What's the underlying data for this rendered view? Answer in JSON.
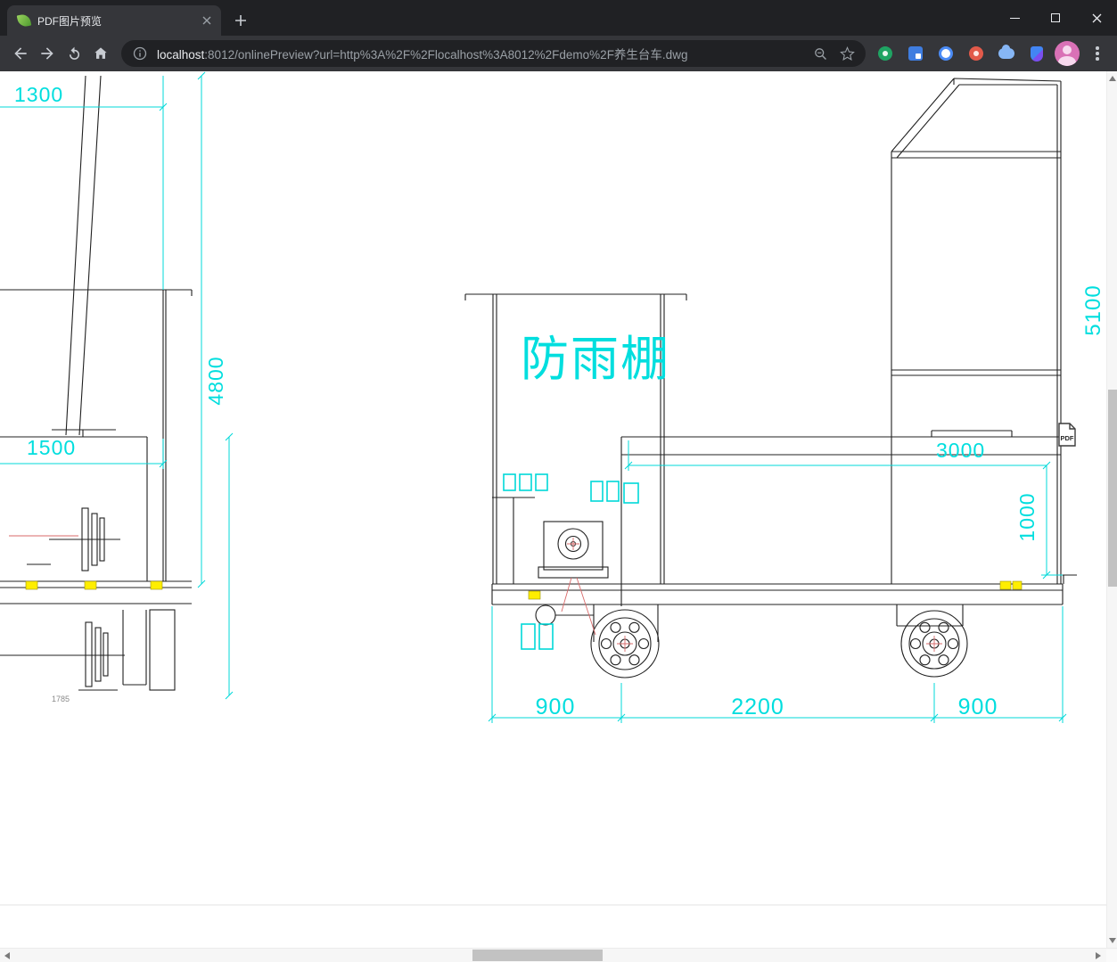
{
  "window": {
    "tab": {
      "title": "PDF图片预览"
    }
  },
  "toolbar": {
    "address": {
      "host": "localhost",
      "rest": ":8012/onlinePreview?url=http%3A%2F%2Flocalhost%3A8012%2Fdemo%2F养生台车.dwg"
    },
    "icons": [
      "back-icon",
      "forward-icon",
      "reload-icon",
      "home-icon",
      "info-icon",
      "zoom-icon",
      "star-icon",
      "extension-green",
      "extension-translate",
      "extension-ring",
      "extension-red",
      "extension-cloud",
      "extension-shield",
      "profile-avatar",
      "menu-icon"
    ]
  },
  "overlay": {
    "pdf_icon_label": "PDF"
  },
  "cad": {
    "shelter_label": "防雨棚",
    "dims": {
      "top_left_width": "1300",
      "left_height": "4800",
      "left_width": "1500",
      "right_height": "5100",
      "platform_width": "3000",
      "platform_height": "1000",
      "axle_left": "900",
      "axle_span": "2200",
      "axle_right": "900",
      "left_lower": "1785"
    },
    "colors": {
      "dimension": "#00dede",
      "line": "#202020",
      "pad": "#ffee00",
      "leader": "#d96a6a"
    }
  }
}
